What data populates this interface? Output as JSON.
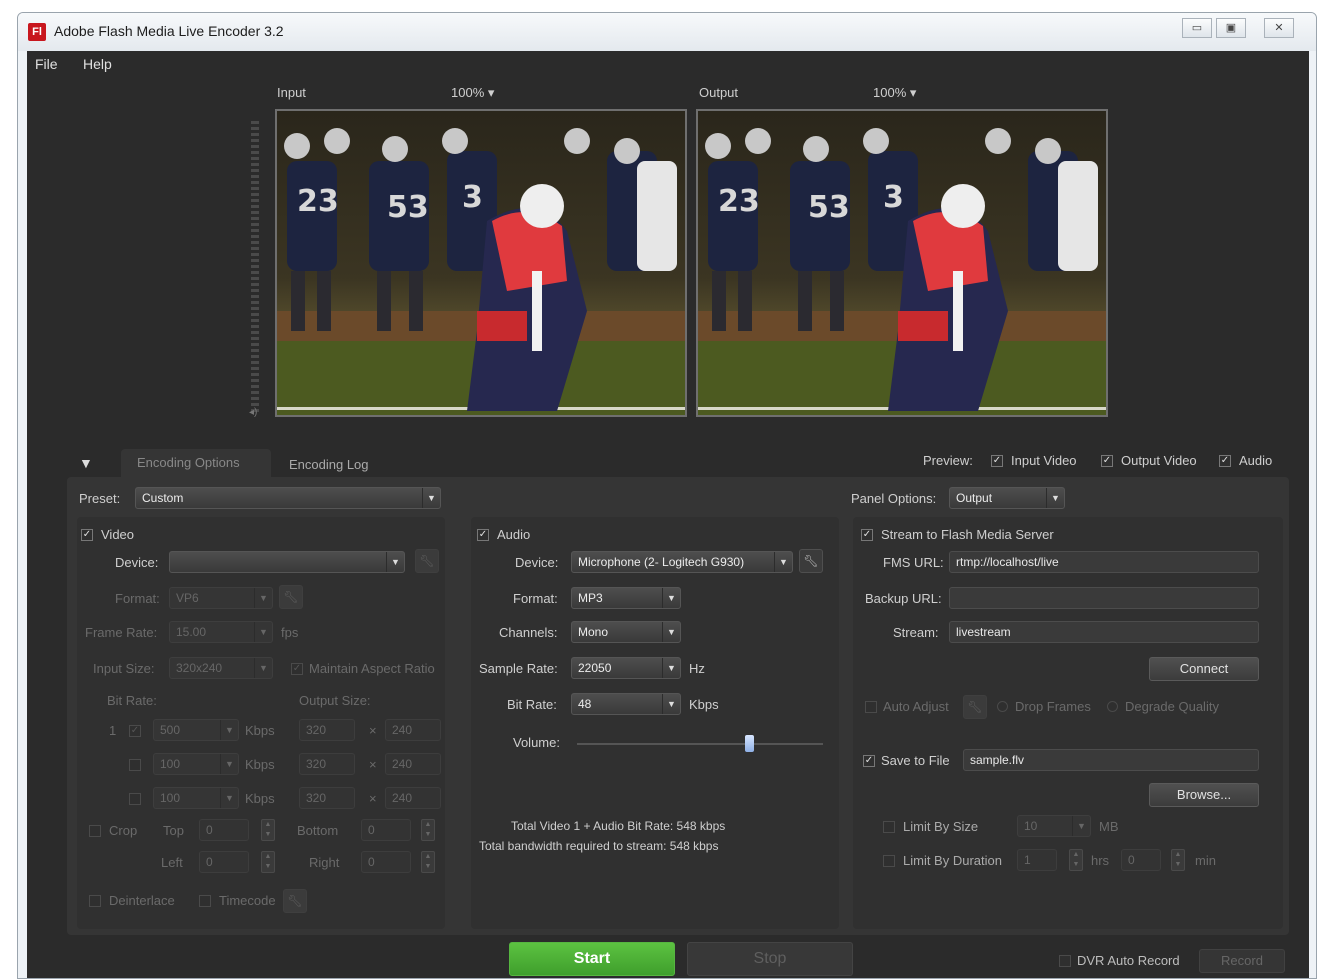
{
  "window": {
    "title": "Adobe Flash Media Live Encoder 3.2",
    "app_icon": "Fl",
    "controls": [
      "▭",
      "▣",
      "✕"
    ]
  },
  "menu": {
    "file": "File",
    "help": "Help"
  },
  "preview": {
    "input_label": "Input",
    "input_zoom": "100%",
    "output_label": "Output",
    "output_zoom": "100%"
  },
  "tabs": {
    "encoding_options": "Encoding Options",
    "encoding_log": "Encoding Log"
  },
  "preview_options": {
    "label": "Preview:",
    "input_video": "Input Video",
    "output_video": "Output Video",
    "audio": "Audio"
  },
  "preset": {
    "label": "Preset:",
    "value": "Custom"
  },
  "panel_options": {
    "label": "Panel Options:",
    "value": "Output"
  },
  "video": {
    "label": "Video",
    "device_label": "Device:",
    "device_value": "",
    "format_label": "Format:",
    "format_value": "VP6",
    "frame_rate_label": "Frame Rate:",
    "frame_rate_value": "15.00",
    "frame_rate_unit": "fps",
    "input_size_label": "Input Size:",
    "input_size_value": "320x240",
    "maintain_aspect": "Maintain Aspect Ratio",
    "bit_rate_header": "Bit Rate:",
    "output_size_header": "Output Size:",
    "rows": [
      {
        "index": "1",
        "bitrate": "500",
        "unit": "Kbps",
        "width": "320",
        "height": "240"
      },
      {
        "index": "",
        "bitrate": "100",
        "unit": "Kbps",
        "width": "320",
        "height": "240"
      },
      {
        "index": "",
        "bitrate": "100",
        "unit": "Kbps",
        "width": "320",
        "height": "240"
      }
    ],
    "crop_label": "Crop",
    "top_label": "Top",
    "top_value": "0",
    "bottom_label": "Bottom",
    "bottom_value": "0",
    "left_label": "Left",
    "left_value": "0",
    "right_label": "Right",
    "right_value": "0",
    "deinterlace": "Deinterlace",
    "timecode": "Timecode"
  },
  "audio": {
    "label": "Audio",
    "device_label": "Device:",
    "device_value": "Microphone (2- Logitech G930)",
    "format_label": "Format:",
    "format_value": "MP3",
    "channels_label": "Channels:",
    "channels_value": "Mono",
    "sample_rate_label": "Sample Rate:",
    "sample_rate_value": "22050",
    "sample_rate_unit": "Hz",
    "bit_rate_label": "Bit Rate:",
    "bit_rate_value": "48",
    "bit_rate_unit": "Kbps",
    "volume_label": "Volume:",
    "volume_level": 0.7,
    "total_line": "Total Video 1 + Audio Bit Rate:  548 kbps",
    "bandwidth_line": "Total bandwidth required to stream:  548 kbps"
  },
  "stream": {
    "label": "Stream to Flash Media Server",
    "fms_url_label": "FMS URL:",
    "fms_url_value": "rtmp://localhost/live",
    "backup_url_label": "Backup URL:",
    "backup_url_value": "",
    "stream_label": "Stream:",
    "stream_value": "livestream",
    "connect": "Connect",
    "auto_adjust": "Auto Adjust",
    "drop_frames": "Drop Frames",
    "degrade_quality": "Degrade Quality",
    "save_to_file": "Save to File",
    "file_value": "sample.flv",
    "browse": "Browse...",
    "limit_by_size": "Limit By Size",
    "size_value": "10",
    "size_unit": "MB",
    "limit_by_duration": "Limit By Duration",
    "hrs_value": "1",
    "hrs_unit": "hrs",
    "min_value": "0",
    "min_unit": "min"
  },
  "bottom": {
    "start": "Start",
    "stop": "Stop",
    "dvr_auto_record": "DVR Auto Record",
    "record": "Record"
  },
  "colors": {
    "start_green": "#3f9f2c",
    "panel_bg": "#2b2b2b",
    "field_bg": "#3a3a3a"
  }
}
